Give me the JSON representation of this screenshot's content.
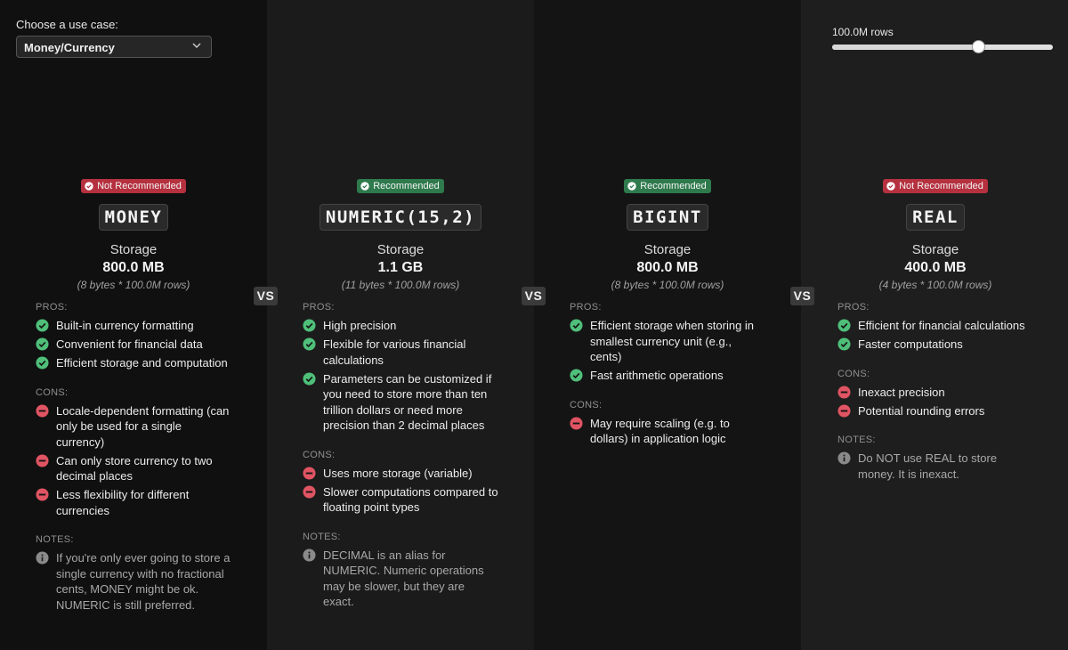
{
  "controls": {
    "usecase_label": "Choose a use case:",
    "usecase_selected": "Money/Currency",
    "rows_label": "100.0M rows",
    "rows_fraction": 0.66
  },
  "vs_label": "VS",
  "labels": {
    "storage": "Storage",
    "pros": "PROS:",
    "cons": "CONS:",
    "notes": "NOTES:"
  },
  "colors": {
    "pro": "#4fbf7a",
    "con": "#e05463",
    "note": "#8a8a8a",
    "recommended": "#2f7a4d",
    "not_recommended": "#b5313f"
  },
  "cards": [
    {
      "badge": "Not Recommended",
      "recommended": false,
      "type": "MONEY",
      "storage": "800.0 MB",
      "detail": "(8 bytes * 100.0M rows)",
      "pros": [
        "Built-in currency formatting",
        "Convenient for financial data",
        "Efficient storage and computation"
      ],
      "cons": [
        "Locale-dependent formatting (can only be used for a single currency)",
        "Can only store currency to two decimal places",
        "Less flexibility for different currencies"
      ],
      "notes": [
        "If you're only ever going to store a single currency with no fractional cents, MONEY might be ok. NUMERIC is still preferred."
      ]
    },
    {
      "badge": "Recommended",
      "recommended": true,
      "type": "NUMERIC(15,2)",
      "storage": "1.1 GB",
      "detail": "(11 bytes * 100.0M rows)",
      "pros": [
        "High precision",
        "Flexible for various financial calculations",
        "Parameters can be customized if you need to store more than ten trillion dollars or need more precision than 2 decimal places"
      ],
      "cons": [
        "Uses more storage (variable)",
        "Slower computations compared to floating point types"
      ],
      "notes": [
        "DECIMAL is an alias for NUMERIC. Numeric operations may be slower, but they are exact."
      ]
    },
    {
      "badge": "Recommended",
      "recommended": true,
      "type": "BIGINT",
      "storage": "800.0 MB",
      "detail": "(8 bytes * 100.0M rows)",
      "pros": [
        "Efficient storage when storing in smallest currency unit (e.g., cents)",
        "Fast arithmetic operations"
      ],
      "cons": [
        "May require scaling (e.g. to dollars) in application logic"
      ],
      "notes": []
    },
    {
      "badge": "Not Recommended",
      "recommended": false,
      "type": "REAL",
      "storage": "400.0 MB",
      "detail": "(4 bytes * 100.0M rows)",
      "pros": [
        "Efficient for financial calculations",
        "Faster computations"
      ],
      "cons": [
        "Inexact precision",
        "Potential rounding errors"
      ],
      "notes": [
        "Do NOT use REAL to store money. It is inexact."
      ]
    }
  ]
}
